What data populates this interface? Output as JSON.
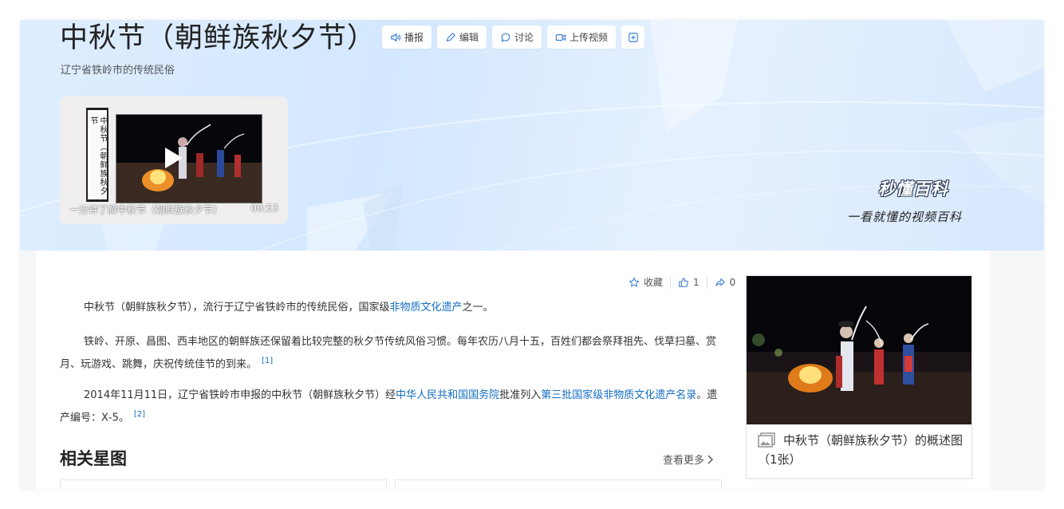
{
  "header": {
    "title": "中秋节（朝鲜族秋夕节）",
    "subtitle": "辽宁省铁岭市的传统民俗",
    "actions": [
      {
        "label": "播报",
        "icon": "speaker-icon"
      },
      {
        "label": "编辑",
        "icon": "pencil-icon"
      },
      {
        "label": "讨论",
        "icon": "chat-bubble-icon"
      },
      {
        "label": "上传视频",
        "icon": "video-camera-icon"
      },
      {
        "label": "",
        "icon": "plus-square-icon"
      }
    ]
  },
  "video": {
    "caption": "一分钟了解中秋节（朝鲜族秋夕节）",
    "duration": "00:53",
    "scroll_text": "中秋节（朝鲜族秋夕节"
  },
  "brand": {
    "name": "秒懂百科",
    "slogan": "一看就懂的视频百科"
  },
  "tools": {
    "favorite_label": "收藏",
    "like_count": "1",
    "share_count": "0"
  },
  "article": {
    "p1": {
      "before": "中秋节（朝鲜族秋夕节），流行于辽宁省铁岭市的传统民俗，国家级",
      "link": "非物质文化遗产",
      "after": "之一。"
    },
    "p2": {
      "text": "铁岭、开原、昌图、西丰地区的朝鲜族还保留着比较完整的秋夕节传统风俗习惯。每年农历八月十五，百姓们都会祭拜祖先、伐草扫墓、赏月、玩游戏、跳舞，庆祝传统佳节的到来。",
      "ref": "[1]"
    },
    "p3": {
      "before": "2014年11月11日，辽宁省铁岭市申报的中秋节（朝鲜族秋夕节）经",
      "link1": "中华人民共和国国务院",
      "middle": "批准列入",
      "link2": "第三批国家级非物质文化遗产名录",
      "after": "。遗产编号：Ⅹ-5。",
      "ref": "[2]"
    }
  },
  "related": {
    "title": "相关星图",
    "see_more": "查看更多"
  },
  "side_card": {
    "caption": "中秋节（朝鲜族秋夕节）的概述图（1张）"
  },
  "colors": {
    "link": "#136ec2",
    "banner": "#d3e7ff"
  }
}
